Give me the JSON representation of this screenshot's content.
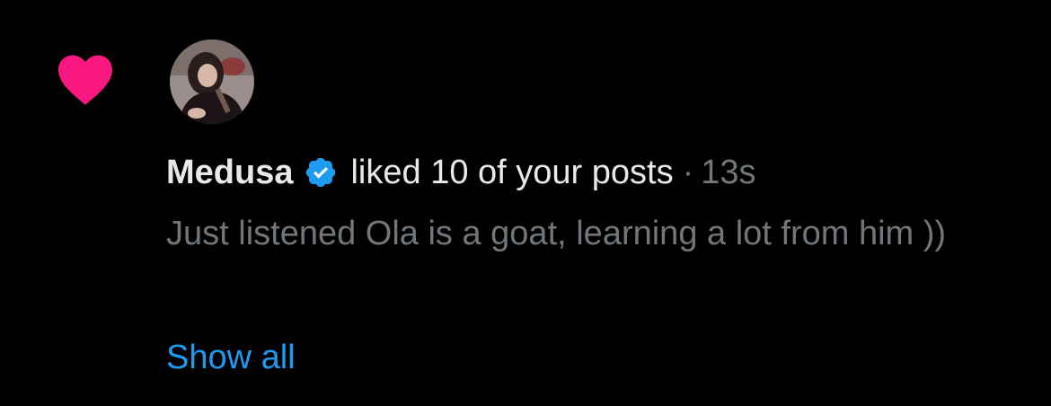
{
  "notification": {
    "type": "like",
    "icon": "heart-icon",
    "user": {
      "name": "Medusa",
      "verified": true,
      "verified_icon": "verified-badge-icon"
    },
    "action_text": "liked 10 of your posts",
    "separator": "·",
    "time": "13s",
    "post_text": "Just listened Ola is a goat, learning a lot from him ))",
    "show_all_label": "Show all"
  },
  "colors": {
    "background": "#000000",
    "heart": "#f91880",
    "primary_text": "#e7e9ea",
    "secondary_text": "#71767b",
    "link": "#1d9bf0",
    "verified_badge": "#1d9bf0"
  }
}
